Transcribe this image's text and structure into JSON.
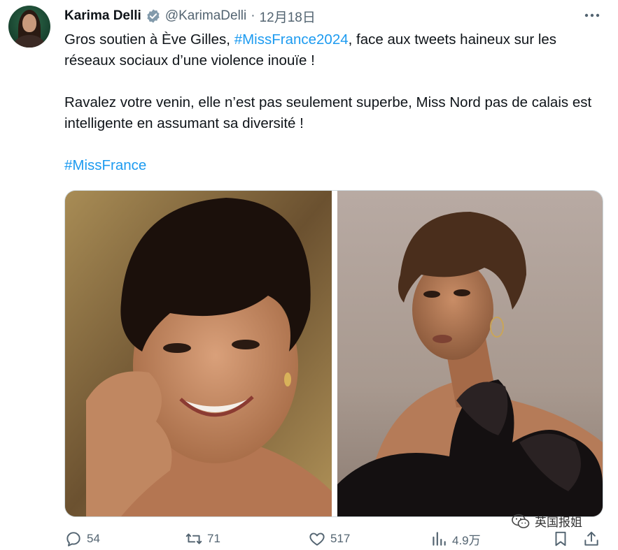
{
  "author": {
    "name": "Karima Delli",
    "handle": "@KarimaDelli",
    "separator": "·",
    "date": "12月18日"
  },
  "tweet": {
    "line1_prefix": "Gros soutien à Ève Gilles, ",
    "line1_hashtag": "#MissFrance2024",
    "line1_suffix": ", face aux  tweets haineux sur les réseaux sociaux d’une violence inouïe !",
    "para2": "Ravalez votre venin, elle n’est pas seulement superbe, Miss Nord pas de calais est intelligente en assumant sa diversité !",
    "para3_hashtag": "#MissFrance"
  },
  "media": {
    "count": 2
  },
  "actions": {
    "reply_count": "54",
    "retweet_count": "71",
    "like_count": "517",
    "views_count": "4.9万"
  },
  "watermark": {
    "text": "英国报姐"
  },
  "colors": {
    "link": "#1d9bf0",
    "muted": "#536471",
    "text": "#0f1419",
    "verified": "#829aab"
  }
}
